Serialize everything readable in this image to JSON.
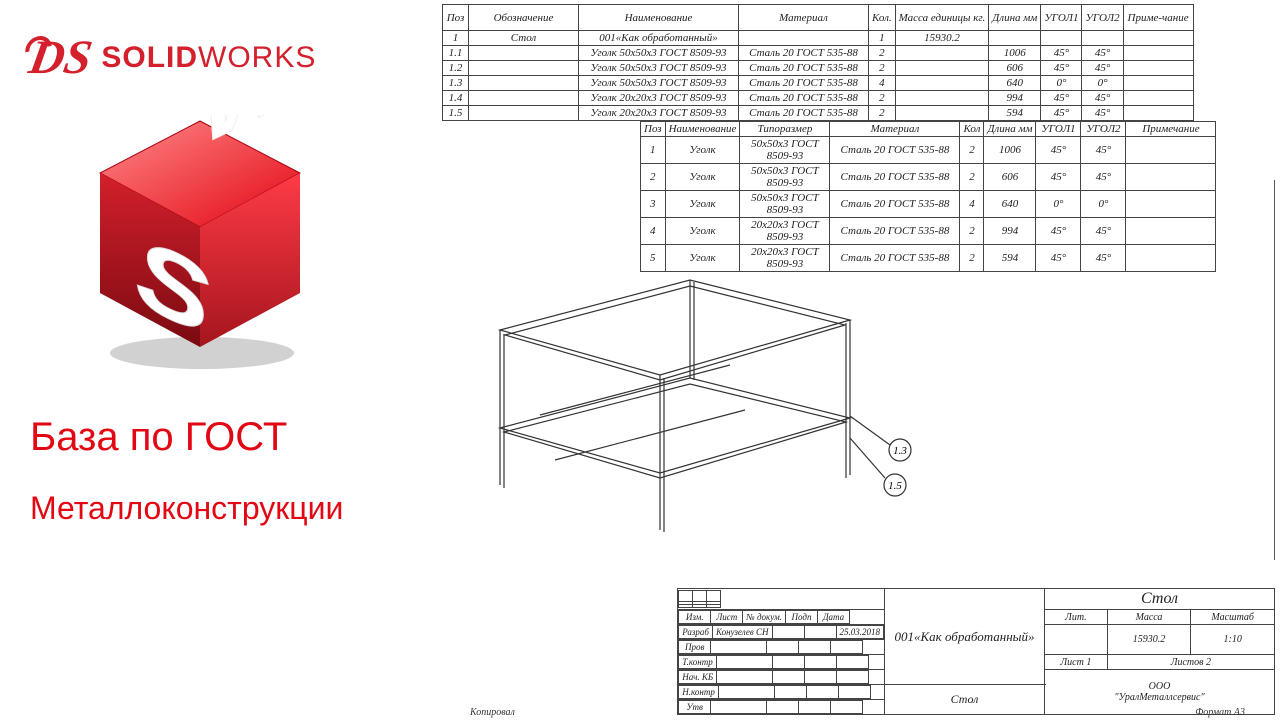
{
  "brand": {
    "solid": "SOLID",
    "works": "WORKS",
    "ds": "DS"
  },
  "title1": "База по ГОСТ",
  "title2": "Металлоконструкции",
  "headers1": [
    "Поз",
    "Обозначение",
    "Наименование",
    "Материал",
    "Кол.",
    "Масса единицы кг.",
    "Длина мм",
    "УГОЛ1",
    "УГОЛ2",
    "Приме-чание"
  ],
  "rows1": [
    [
      "1",
      "Стол",
      "001«Как обработанный»",
      "",
      "1",
      "15930.2",
      "",
      "",
      "",
      ""
    ],
    [
      "1.1",
      "",
      "Уголк 50x50x3 ГОСТ 8509-93",
      "Сталь 20 ГОСТ 535-88",
      "2",
      "",
      "1006",
      "45°",
      "45°",
      ""
    ],
    [
      "1.2",
      "",
      "Уголк 50x50x3 ГОСТ 8509-93",
      "Сталь 20 ГОСТ 535-88",
      "2",
      "",
      "606",
      "45°",
      "45°",
      ""
    ],
    [
      "1.3",
      "",
      "Уголк 50x50x3 ГОСТ 8509-93",
      "Сталь 20 ГОСТ 535-88",
      "4",
      "",
      "640",
      "0°",
      "0°",
      ""
    ],
    [
      "1.4",
      "",
      "Уголк 20x20x3 ГОСТ 8509-93",
      "Сталь 20 ГОСТ 535-88",
      "2",
      "",
      "994",
      "45°",
      "45°",
      ""
    ],
    [
      "1.5",
      "",
      "Уголк 20x20x3 ГОСТ 8509-93",
      "Сталь 20 ГОСТ 535-88",
      "2",
      "",
      "594",
      "45°",
      "45°",
      ""
    ]
  ],
  "headers2": [
    "Поз",
    "Наименование",
    "Типоразмер",
    "Материал",
    "Кол",
    "Длина мм",
    "УГОЛ1",
    "УГОЛ2",
    "Примечание"
  ],
  "rows2": [
    [
      "1",
      "Уголк",
      "50x50x3 ГОСТ 8509-93",
      "Сталь 20 ГОСТ 535-88",
      "2",
      "1006",
      "45°",
      "45°",
      ""
    ],
    [
      "2",
      "Уголк",
      "50x50x3 ГОСТ 8509-93",
      "Сталь 20 ГОСТ 535-88",
      "2",
      "606",
      "45°",
      "45°",
      ""
    ],
    [
      "3",
      "Уголк",
      "50x50x3 ГОСТ 8509-93",
      "Сталь 20 ГОСТ 535-88",
      "4",
      "640",
      "0°",
      "0°",
      ""
    ],
    [
      "4",
      "Уголк",
      "20x20x3 ГОСТ 8509-93",
      "Сталь 20 ГОСТ 535-88",
      "2",
      "994",
      "45°",
      "45°",
      ""
    ],
    [
      "5",
      "Уголк",
      "20x20x3 ГОСТ 8509-93",
      "Сталь 20 ГОСТ 535-88",
      "2",
      "594",
      "45°",
      "45°",
      ""
    ]
  ],
  "callouts": [
    "1.3",
    "1.5"
  ],
  "stamp": {
    "title": "Стол",
    "sub": "001«Как обработанный»",
    "cols": [
      "Изм.",
      "Лист",
      "№ докум.",
      "Подп",
      "Дата"
    ],
    "rows": [
      [
        "Разраб",
        "Конузелев СН",
        "",
        "",
        "25.03.2018"
      ],
      [
        "Пров",
        "",
        "",
        "",
        ""
      ],
      [
        "Т.контр",
        "",
        "",
        "",
        ""
      ],
      [
        "Нач. КБ",
        "",
        "",
        "",
        ""
      ],
      [
        "Н.контр",
        "",
        "",
        "",
        ""
      ],
      [
        "Утв",
        "",
        "",
        "",
        ""
      ]
    ],
    "lit": "Лит.",
    "massa": "Масса",
    "masshtab": "Масштаб",
    "massa_v": "15930.2",
    "masshtab_v": "1:10",
    "list": "Лист 1",
    "listov": "Листов 2",
    "org": "ООО\n\"УралМеталлсервис\"",
    "side": "Стол"
  },
  "footer": {
    "left": "Копировал",
    "right": "Формат А3"
  }
}
